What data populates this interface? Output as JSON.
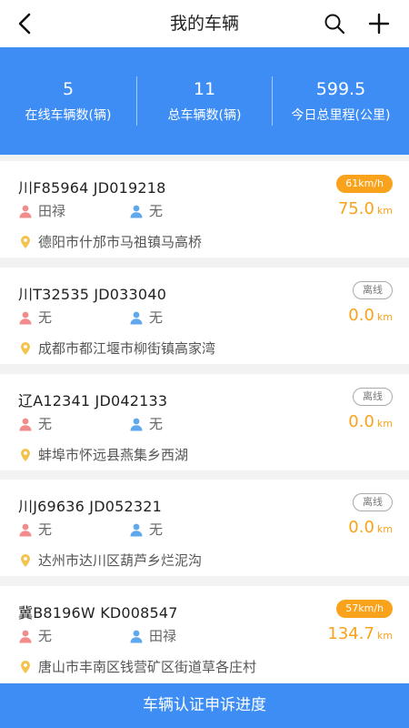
{
  "header": {
    "title": "我的车辆"
  },
  "stats": [
    {
      "value": "5",
      "label": "在线车辆数(辆)"
    },
    {
      "value": "11",
      "label": "总车辆数(辆)"
    },
    {
      "value": "599.5",
      "label": "今日总里程(公里)"
    }
  ],
  "vehicles": [
    {
      "plate": "川F85964  JD019218",
      "status": "61km/h",
      "status_type": "speed",
      "driver": "田禄",
      "copilot": "无",
      "mileage": "75.0",
      "unit": "km",
      "address": "德阳市什邡市马祖镇马高桥"
    },
    {
      "plate": "川T32535  JD033040",
      "status": "离线",
      "status_type": "offline",
      "driver": "无",
      "copilot": "无",
      "mileage": "0.0",
      "unit": "km",
      "address": "成都市都江堰市柳街镇高家湾"
    },
    {
      "plate": "辽A12341  JD042133",
      "status": "离线",
      "status_type": "offline",
      "driver": "无",
      "copilot": "无",
      "mileage": "0.0",
      "unit": "km",
      "address": "蚌埠市怀远县燕集乡西湖"
    },
    {
      "plate": "川J69636  JD052321",
      "status": "离线",
      "status_type": "offline",
      "driver": "无",
      "copilot": "无",
      "mileage": "0.0",
      "unit": "km",
      "address": "达州市达川区葫芦乡烂泥沟"
    },
    {
      "plate": "冀B8196W  KD008547",
      "status": "57km/h",
      "status_type": "speed",
      "driver": "无",
      "copilot": "田禄",
      "mileage": "134.7",
      "unit": "km",
      "address": "唐山市丰南区钱营矿区街道草各庄村"
    }
  ],
  "footer": {
    "label": "车辆认证申诉进度"
  },
  "colors": {
    "primary": "#3d8df5",
    "accent": "#f9a21b",
    "driver_icon": "#f28c8c",
    "copilot_icon": "#5fa8ee",
    "location_icon": "#f2c44f"
  },
  "icons": {
    "back": "chevron-left-icon",
    "search": "search-icon",
    "add": "plus-icon",
    "driver": "person-icon",
    "copilot": "person-icon",
    "location": "location-pin-icon"
  }
}
